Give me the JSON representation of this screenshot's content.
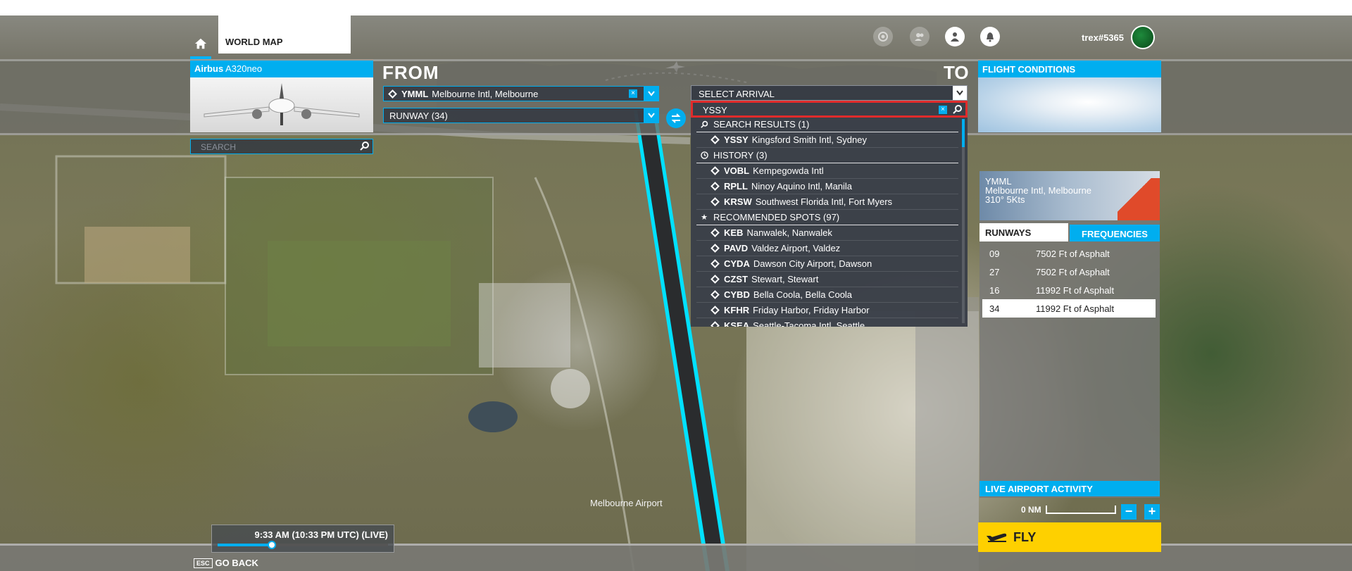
{
  "header": {
    "world_map_tab": "WORLD MAP",
    "username": "trex#5365"
  },
  "aircraft": {
    "brand": "Airbus",
    "model": "A320neo"
  },
  "route": {
    "from_label": "FROM",
    "to_label": "TO",
    "departure_code": "YMML",
    "departure_name": "Melbourne Intl, Melbourne",
    "departure_runway": "RUNWAY (34)",
    "arrival_placeholder": "SELECT ARRIVAL",
    "arrival_search_value": "YSSY"
  },
  "dropdown": {
    "search_results_header": "SEARCH RESULTS (1)",
    "history_header": "HISTORY (3)",
    "recommended_header": "RECOMMENDED SPOTS (97)",
    "search_results": [
      {
        "code": "YSSY",
        "name": "Kingsford Smith Intl, Sydney"
      }
    ],
    "history": [
      {
        "code": "VOBL",
        "name": "Kempegowda Intl"
      },
      {
        "code": "RPLL",
        "name": "Ninoy Aquino Intl, Manila"
      },
      {
        "code": "KRSW",
        "name": "Southwest Florida Intl, Fort Myers"
      }
    ],
    "recommended": [
      {
        "code": "KEB",
        "name": "Nanwalek, Nanwalek"
      },
      {
        "code": "PAVD",
        "name": "Valdez Airport, Valdez"
      },
      {
        "code": "CYDA",
        "name": "Dawson City Airport, Dawson"
      },
      {
        "code": "CZST",
        "name": "Stewart, Stewart"
      },
      {
        "code": "CYBD",
        "name": "Bella Coola, Bella Coola"
      },
      {
        "code": "KFHR",
        "name": "Friday Harbor, Friday Harbor"
      },
      {
        "code": "KSEA",
        "name": "Seattle-Tacoma Intl, Seattle"
      }
    ]
  },
  "conditions": {
    "title": "FLIGHT CONDITIONS"
  },
  "map_search": {
    "placeholder": "SEARCH"
  },
  "airport_info": {
    "code": "YMML",
    "name": "Melbourne Intl, Melbourne",
    "wind": "310° 5Kts",
    "tab_runways": "RUNWAYS",
    "tab_frequencies": "FREQUENCIES",
    "runways": [
      {
        "id": "09",
        "desc": "7502 Ft of Asphalt"
      },
      {
        "id": "27",
        "desc": "7502 Ft of Asphalt"
      },
      {
        "id": "16",
        "desc": "11992 Ft of Asphalt"
      },
      {
        "id": "34",
        "desc": "11992 Ft of Asphalt"
      }
    ],
    "live_activity": "LIVE AIRPORT ACTIVITY"
  },
  "map": {
    "scale": "0 NM",
    "zoom_out": "−",
    "zoom_in": "+",
    "airport_label": "Melbourne Airport"
  },
  "fly_label": "FLY",
  "time": {
    "text": "9:33 AM (10:33 PM UTC) (LIVE)",
    "progress": 0.32
  },
  "footer": {
    "esc": "ESC",
    "go_back": "GO BACK"
  },
  "colors": {
    "accent": "#00aeef",
    "fly": "#fed000",
    "highlight": "#e02b2b"
  }
}
